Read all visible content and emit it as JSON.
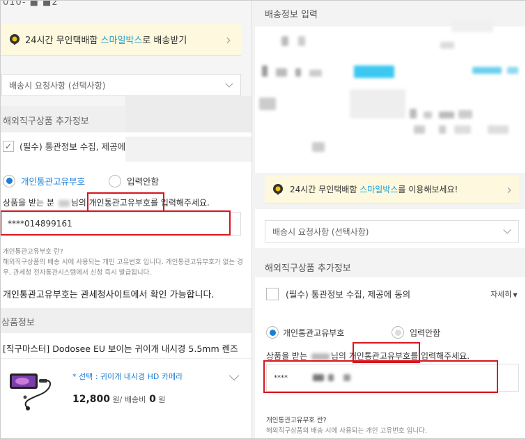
{
  "left": {
    "phone_fragment": "010-  ■  ■2",
    "banner": {
      "prefix": "24시간 무인택배함 ",
      "highlight": "스마일박스",
      "suffix": "로 배송받기"
    },
    "delivery_request_placeholder": "배송시 요청사항 (선택사항)",
    "overseas_section_title": "해외직구상품 추가정보",
    "consent_label": "(필수) 통관정보 수집, 제공에",
    "radio_customs_id": "개인통관고유부호",
    "radio_no_input": "입력안함",
    "recipient_prefix": "상품을 받는 분",
    "recipient_mid": "님의",
    "recipient_highlight": "개인통관고유부호를",
    "recipient_suffix": " 입력해주세요.",
    "customs_input_value": "****014899161",
    "help_title": "개인통관고유부호 란?",
    "help_body": "해외직구상품의 배송 시에 사용되는 개인 고유번호 입니다. 개인통관고유부호가 없는 경우, 관세청 전자통관시스템에서 신청 즉시 발급됩니다.",
    "help_emphasis": "개인통관고유부호는 관세청사이트에서 확인 가능합니다.",
    "product_section_title": "상품정보",
    "product_title": "[직구마스터] Dodosee EU 보이는 귀이개 내시경 5.5mm 렌즈",
    "option_text": "* 선택 : 귀이개 내시경 HD 카메라",
    "price": "12,800",
    "price_unit": "원",
    "shipping_label": "/ 배송비",
    "shipping_value": "0",
    "shipping_unit": "원"
  },
  "right": {
    "section_title": "배송정보 입력",
    "banner": {
      "prefix": "24시간 무인택배함 ",
      "highlight": "스마일박스",
      "suffix": "를 이용해보세요!"
    },
    "delivery_request_placeholder": "배송시 요청사항 (선택사항)",
    "overseas_section_title": "해외직구상품 추가정보",
    "consent_label": "(필수) 통관정보 수집, 제공에 동의",
    "detail_link": "자세히",
    "radio_customs_id": "개인통관고유부호",
    "radio_no_input": "입력안함",
    "recipient_prefix": "상품을 받는",
    "recipient_mid": "님의",
    "recipient_highlight": "개인통관고유부호를",
    "recipient_suffix": " 입력해주세요.",
    "customs_input_value": "****",
    "help_title": "개인통관고유부호 란?",
    "help_body": "해외직구상품의 배송 시에 사용되는 개인 고유번호 입니다."
  },
  "colors": {
    "accent_blue": "#1a9fd8",
    "highlight_red": "#d9141e",
    "banner_bg": "#fdf8de"
  }
}
